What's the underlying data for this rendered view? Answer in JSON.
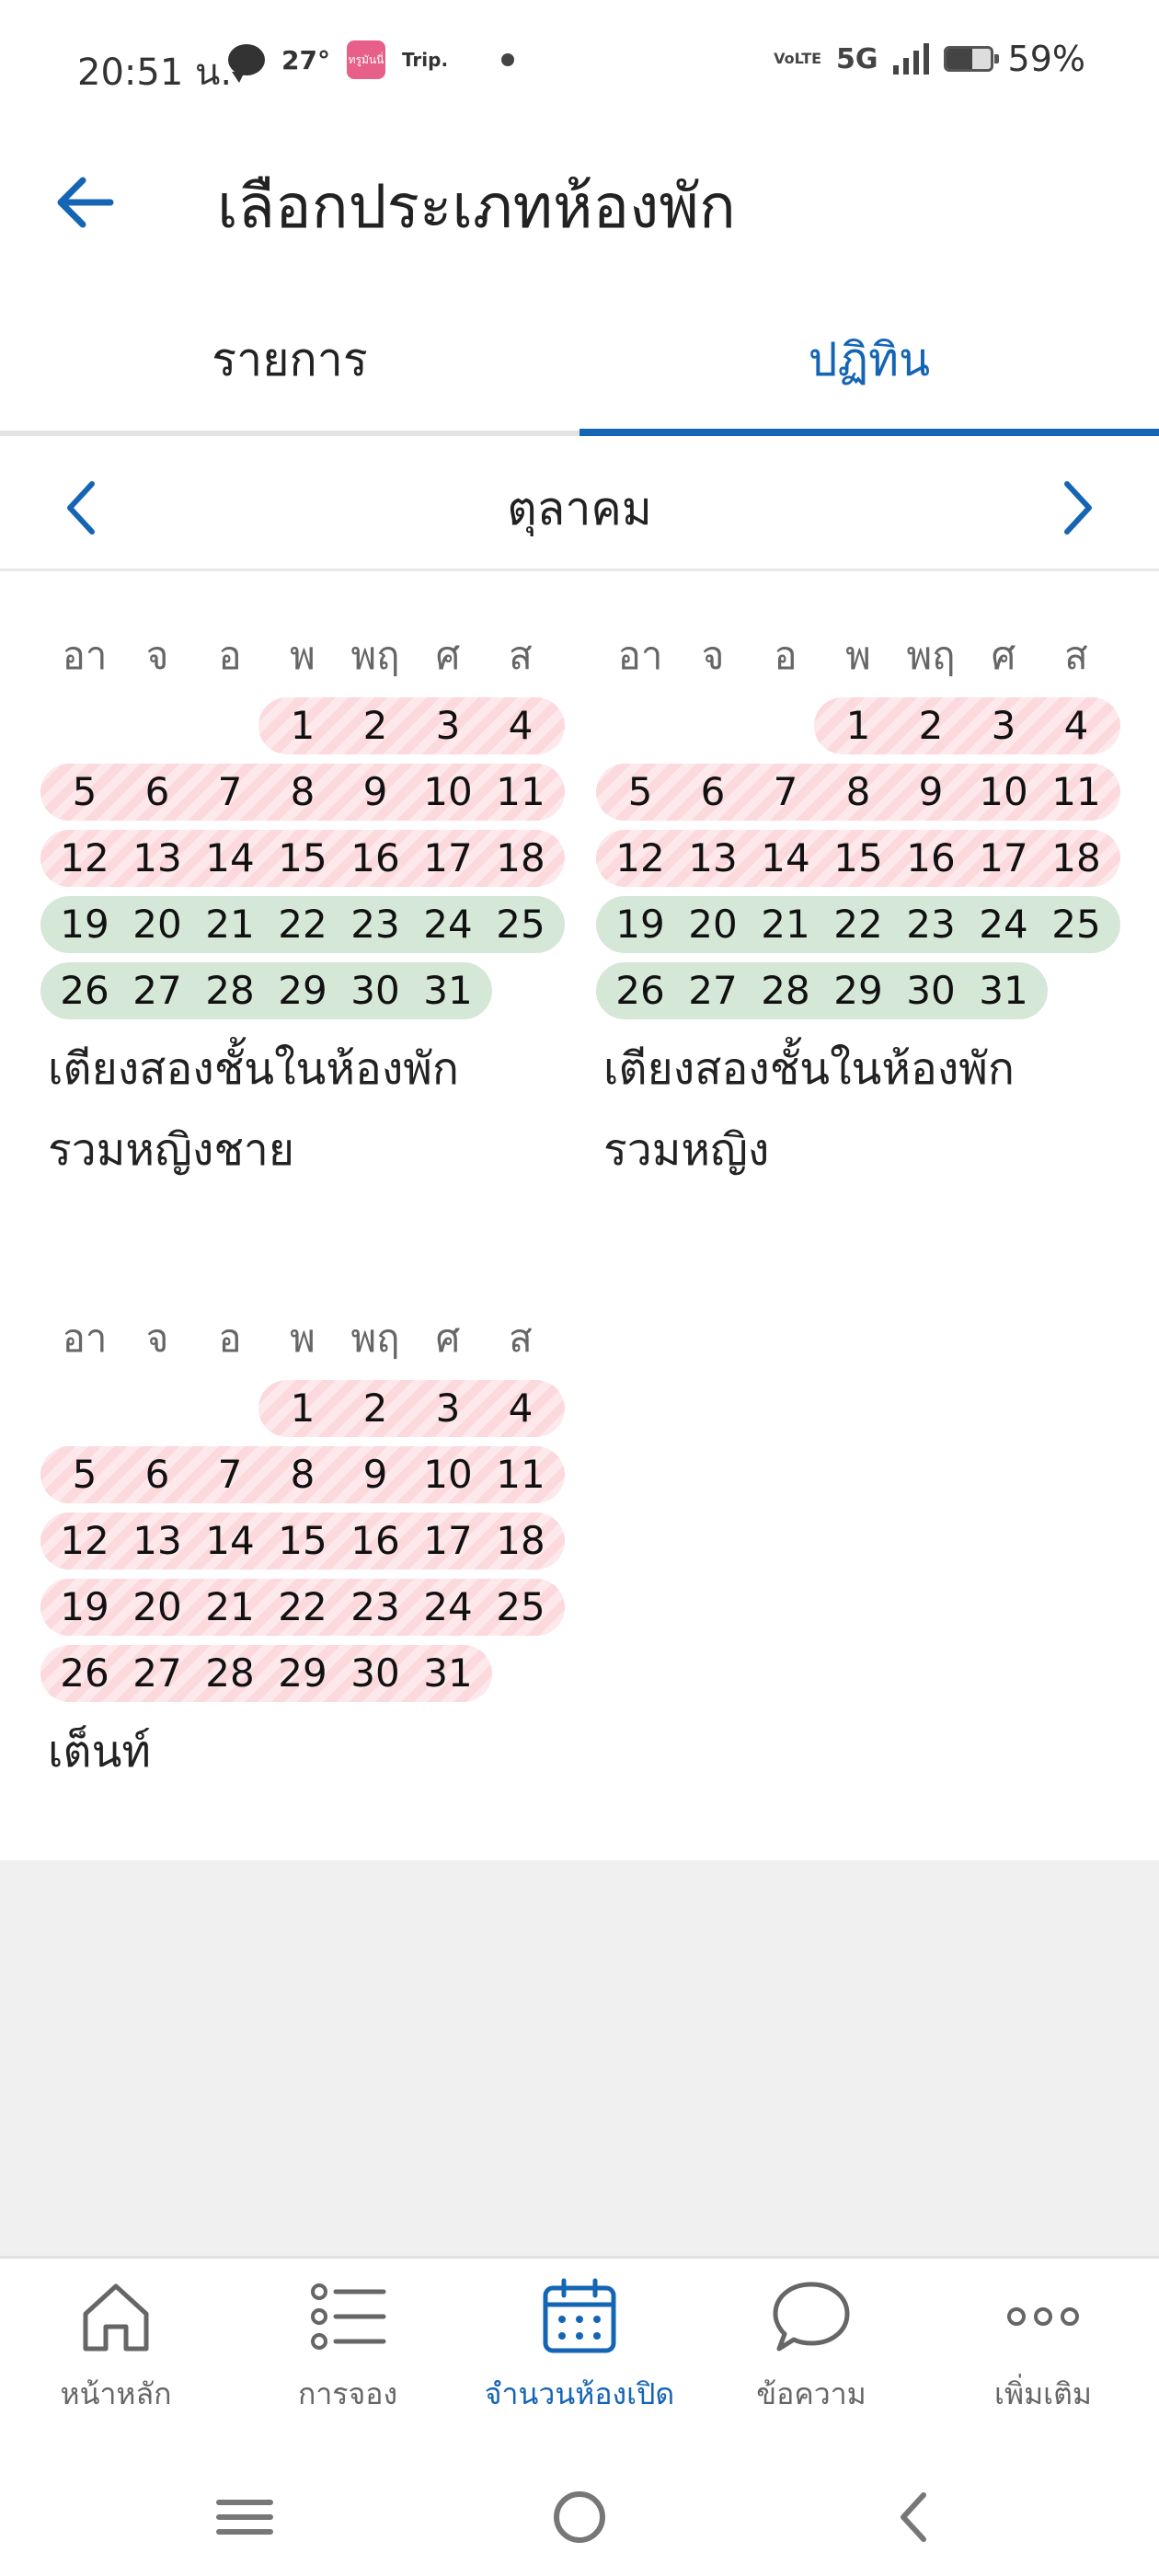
{
  "status_bar": {
    "time": "20:51 น.",
    "temperature": "27°",
    "app_badge": "ทรูมันนี่",
    "trip_label": "Trip.",
    "lte_label": "VoLTE",
    "network": "5G",
    "battery_percent": "59%",
    "battery_level": 0.59
  },
  "header": {
    "title": "เลือกประเภทห้องพัก",
    "back_icon": "arrow-left-icon"
  },
  "tabs": [
    {
      "label": "รายการ",
      "selected": false
    },
    {
      "label": "ปฏิทิน",
      "selected": true
    }
  ],
  "month_nav": {
    "month": "ตุลาคม",
    "prev_icon": "chevron-left-icon",
    "next_icon": "chevron-right-icon"
  },
  "weekdays": [
    "อา",
    "จ",
    "อ",
    "พ",
    "พฤ",
    "ศ",
    "ส"
  ],
  "calendars": [
    {
      "name_line1": "เตียงสองชั้นในห้องพัก",
      "name_line2": "รวมหญิงชาย",
      "rows": [
        {
          "days": [
            "",
            "",
            "",
            "1",
            "2",
            "3",
            "4"
          ],
          "status": "unavailable"
        },
        {
          "days": [
            "5",
            "6",
            "7",
            "8",
            "9",
            "10",
            "11"
          ],
          "status": "unavailable"
        },
        {
          "days": [
            "12",
            "13",
            "14",
            "15",
            "16",
            "17",
            "18"
          ],
          "status": "unavailable"
        },
        {
          "days": [
            "19",
            "20",
            "21",
            "22",
            "23",
            "24",
            "25"
          ],
          "status": "available"
        },
        {
          "days": [
            "26",
            "27",
            "28",
            "29",
            "30",
            "31",
            ""
          ],
          "status": "available"
        }
      ]
    },
    {
      "name_line1": "เตียงสองชั้นในห้องพัก",
      "name_line2": "รวมหญิง",
      "rows": [
        {
          "days": [
            "",
            "",
            "",
            "1",
            "2",
            "3",
            "4"
          ],
          "status": "unavailable"
        },
        {
          "days": [
            "5",
            "6",
            "7",
            "8",
            "9",
            "10",
            "11"
          ],
          "status": "unavailable"
        },
        {
          "days": [
            "12",
            "13",
            "14",
            "15",
            "16",
            "17",
            "18"
          ],
          "status": "unavailable"
        },
        {
          "days": [
            "19",
            "20",
            "21",
            "22",
            "23",
            "24",
            "25"
          ],
          "status": "available"
        },
        {
          "days": [
            "26",
            "27",
            "28",
            "29",
            "30",
            "31",
            ""
          ],
          "status": "available"
        }
      ]
    },
    {
      "name_line1": "เต็นท์",
      "name_line2": "",
      "rows": [
        {
          "days": [
            "",
            "",
            "",
            "1",
            "2",
            "3",
            "4"
          ],
          "status": "unavailable"
        },
        {
          "days": [
            "5",
            "6",
            "7",
            "8",
            "9",
            "10",
            "11"
          ],
          "status": "unavailable"
        },
        {
          "days": [
            "12",
            "13",
            "14",
            "15",
            "16",
            "17",
            "18"
          ],
          "status": "unavailable"
        },
        {
          "days": [
            "19",
            "20",
            "21",
            "22",
            "23",
            "24",
            "25"
          ],
          "status": "unavailable"
        },
        {
          "days": [
            "26",
            "27",
            "28",
            "29",
            "30",
            "31",
            ""
          ],
          "status": "unavailable"
        }
      ]
    }
  ],
  "bottom_nav": [
    {
      "label": "หน้าหลัก",
      "icon": "home-icon",
      "active": false
    },
    {
      "label": "การจอง",
      "icon": "list-icon",
      "active": false
    },
    {
      "label": "จำนวนห้องเปิด",
      "icon": "calendar-icon",
      "active": true
    },
    {
      "label": "ข้อความ",
      "icon": "chat-icon",
      "active": false
    },
    {
      "label": "เพิ่มเติม",
      "icon": "more-icon",
      "active": false
    }
  ],
  "colors": {
    "accent": "#1565b5",
    "unavailable": "#fbd9dd",
    "available": "#d5e7d7"
  }
}
